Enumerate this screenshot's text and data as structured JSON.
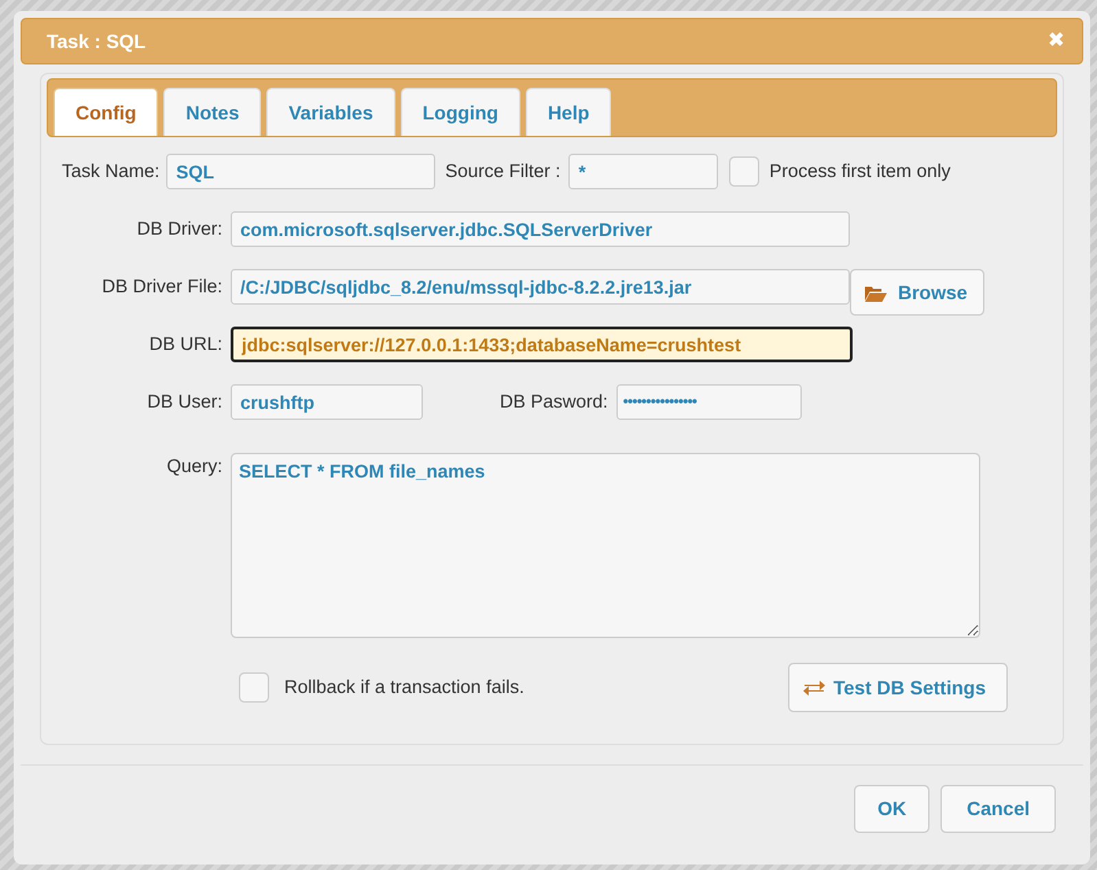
{
  "dialog": {
    "title": "Task : SQL",
    "close": "✖"
  },
  "tabs": [
    {
      "label": "Config",
      "selected": true
    },
    {
      "label": "Notes",
      "selected": false
    },
    {
      "label": "Variables",
      "selected": false
    },
    {
      "label": "Logging",
      "selected": false
    },
    {
      "label": "Help",
      "selected": false
    }
  ],
  "form": {
    "task_name": {
      "label": "Task Name:",
      "value": "SQL"
    },
    "source_filter": {
      "label": "Source Filter :",
      "value": "*"
    },
    "process_first": {
      "label": "Process first item only",
      "checked": false
    },
    "db_driver": {
      "label": "DB Driver:",
      "value": "com.microsoft.sqlserver.jdbc.SQLServerDriver"
    },
    "db_driver_file": {
      "label": "DB Driver File:",
      "value": "/C:/JDBC/sqljdbc_8.2/enu/mssql-jdbc-8.2.2.jre13.jar"
    },
    "browse_button": "Browse",
    "db_url": {
      "label": "DB URL:",
      "value": "jdbc:sqlserver://127.0.0.1:1433;databaseName=crushtest",
      "focused": true
    },
    "db_user": {
      "label": "DB User:",
      "value": "crushftp"
    },
    "db_password": {
      "label": "DB Pasword:",
      "value": "••••••••••••••••"
    },
    "query": {
      "label": "Query:",
      "value": "SELECT * FROM file_names"
    },
    "rollback": {
      "label": "Rollback if a transaction fails.",
      "checked": false
    },
    "test_button": "Test DB Settings"
  },
  "buttons": [
    "OK",
    "Cancel"
  ]
}
